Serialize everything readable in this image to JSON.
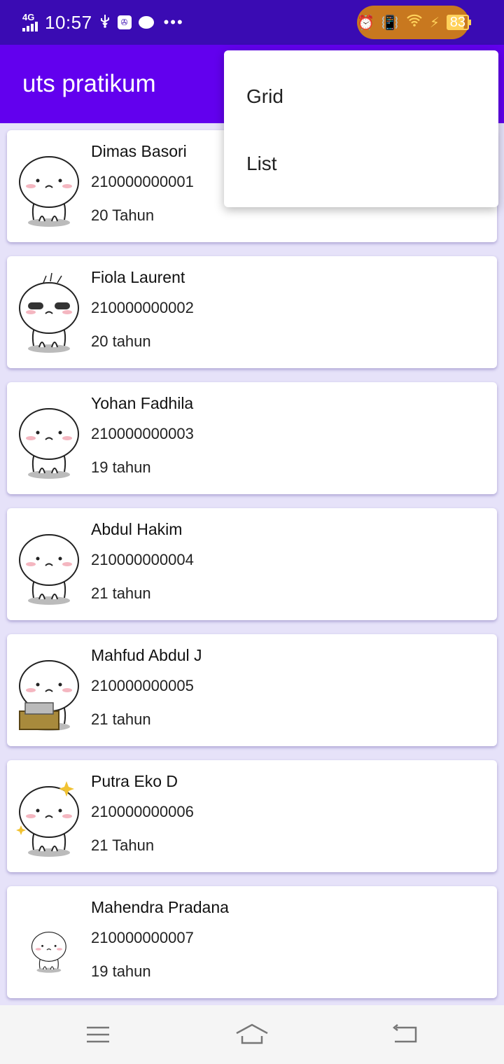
{
  "status_bar": {
    "network": "4G",
    "time": "10:57",
    "usb_label": "⚲",
    "more_label": "•••",
    "battery": "83"
  },
  "app_bar": {
    "title": "uts pratikum"
  },
  "menu": {
    "items": [
      "Grid",
      "List"
    ]
  },
  "students": [
    {
      "name": "Dimas Basori",
      "nim": "210000000001",
      "age": "20 Tahun",
      "avatar": "neutral-face"
    },
    {
      "name": "Fiola Laurent",
      "nim": "210000000002",
      "age": "20 tahun",
      "avatar": "tired-face"
    },
    {
      "name": "Yohan Fadhila",
      "nim": "210000000003",
      "age": "19 tahun",
      "avatar": "worried-face"
    },
    {
      "name": "Abdul Hakim",
      "nim": "210000000004",
      "age": "21 tahun",
      "avatar": "sad-face"
    },
    {
      "name": "Mahfud Abdul J",
      "nim": "210000000005",
      "age": "21 tahun",
      "avatar": "laptop-face"
    },
    {
      "name": "Putra Eko D",
      "nim": "210000000006",
      "age": "21 Tahun",
      "avatar": "thinking-face"
    },
    {
      "name": "Mahendra Pradana",
      "nim": "210000000007",
      "age": "19 tahun",
      "avatar": "small-face"
    }
  ],
  "colors": {
    "status_bar": "#3a0bb3",
    "app_bar": "#6200ee",
    "list_background": "#e6e2f9"
  }
}
